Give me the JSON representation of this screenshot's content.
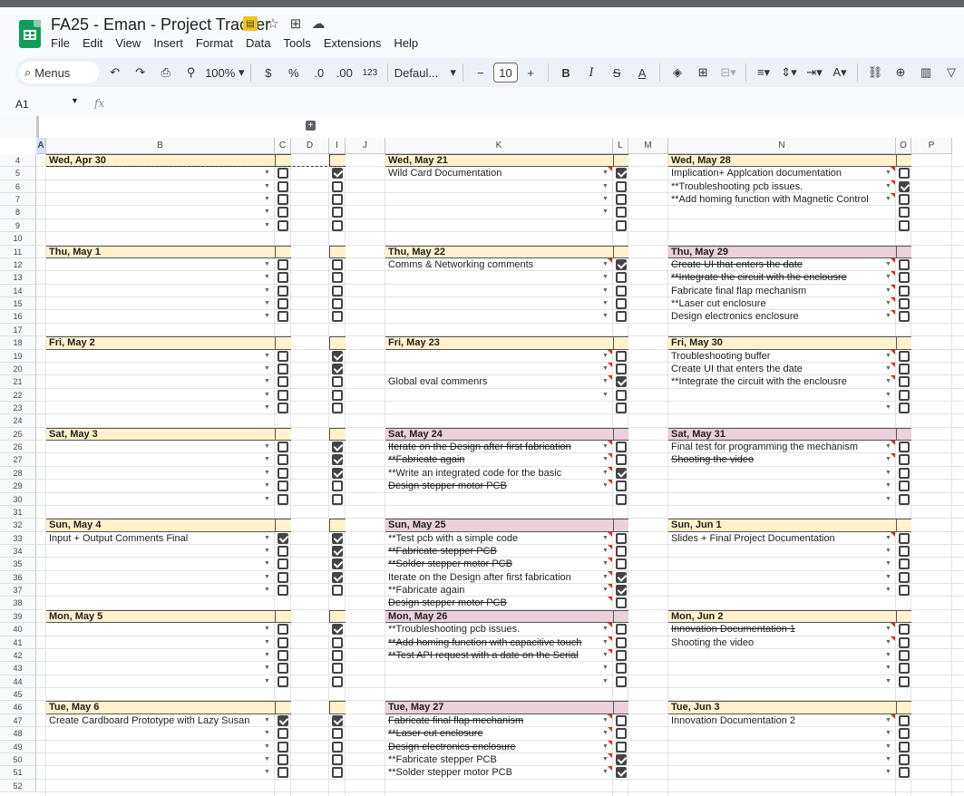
{
  "app": {
    "doc_title": "FA25 - Eman - Project Tracker",
    "menus": [
      "File",
      "Edit",
      "View",
      "Insert",
      "Format",
      "Data",
      "Tools",
      "Extensions",
      "Help"
    ]
  },
  "toolbar": {
    "search_label": "Menus",
    "zoom": "100%",
    "currency": "$",
    "percent": "%",
    "dec_decrease": ".0",
    "dec_increase": ".00",
    "number_format": "123",
    "font": "Defaul...",
    "font_size": "10",
    "bold": "B",
    "italic": "I",
    "strike": "S",
    "textcolor": "A"
  },
  "formula": {
    "cell": "A1",
    "fx": "fx"
  },
  "columns": [
    {
      "id": "A"
    },
    {
      "id": "B"
    },
    {
      "id": "C"
    },
    {
      "id": "D"
    },
    {
      "id": "I"
    },
    {
      "id": "J"
    },
    {
      "id": "K"
    },
    {
      "id": "L"
    },
    {
      "id": "M"
    },
    {
      "id": "N"
    },
    {
      "id": "O"
    },
    {
      "id": "P"
    }
  ],
  "rows": [
    "4",
    "5",
    "6",
    "7",
    "8",
    "9",
    "10",
    "11",
    "12",
    "13",
    "14",
    "15",
    "16",
    "17",
    "18",
    "19",
    "20",
    "21",
    "22",
    "23",
    "24",
    "25",
    "26",
    "27",
    "28",
    "29",
    "30",
    "31",
    "32",
    "33",
    "34",
    "35",
    "36",
    "37",
    "38",
    "39",
    "40",
    "41",
    "42",
    "43",
    "44",
    "45",
    "46",
    "47",
    "48",
    "49",
    "50",
    "51",
    "52"
  ],
  "blocks": [
    {
      "col": "B",
      "row": 0,
      "title": "Wed, Apr 30",
      "color": "y",
      "tasks": [],
      "checks": [
        0,
        0,
        0,
        0,
        0
      ],
      "dropdowns": 5,
      "icol": [
        1,
        0,
        0,
        0,
        0
      ]
    },
    {
      "col": "B",
      "row": 7,
      "title": "Thu, May 1",
      "color": "y",
      "tasks": [],
      "checks": [
        0,
        0,
        0,
        0,
        0
      ],
      "dropdowns": 5,
      "icol": [
        0,
        0,
        0,
        0,
        0
      ]
    },
    {
      "col": "B",
      "row": 14,
      "title": "Fri, May 2",
      "color": "y",
      "tasks": [],
      "checks": [
        0,
        0,
        0,
        0,
        0
      ],
      "dropdowns": 5,
      "icol": [
        1,
        1,
        0,
        0,
        0
      ]
    },
    {
      "col": "B",
      "row": 21,
      "title": "Sat, May 3",
      "color": "y",
      "tasks": [],
      "checks": [
        0,
        0,
        0,
        0,
        0
      ],
      "dropdowns": 5,
      "icol": [
        1,
        1,
        1,
        0,
        0
      ]
    },
    {
      "col": "B",
      "row": 28,
      "title": "Sun, May 4",
      "color": "y",
      "tasks": [
        {
          "t": "Input + Output Comments Final",
          "d": false
        }
      ],
      "checks": [
        1,
        0,
        0,
        0,
        0
      ],
      "dropdowns": 5,
      "icol": [
        1,
        1,
        1,
        1,
        0
      ]
    },
    {
      "col": "B",
      "row": 35,
      "title": "Mon, May 5",
      "color": "y",
      "tasks": [],
      "checks": [
        0,
        0,
        0,
        0,
        0
      ],
      "dropdowns": 5,
      "icol": [
        1,
        0,
        0,
        0,
        0
      ]
    },
    {
      "col": "B",
      "row": 42,
      "title": "Tue, May 6",
      "color": "y",
      "tasks": [
        {
          "t": "Create Cardboard Prototype with Lazy Susan",
          "d": false
        }
      ],
      "checks": [
        1,
        0,
        0,
        0,
        0
      ],
      "dropdowns": 5,
      "icol": [
        1,
        0,
        0,
        0,
        0
      ]
    },
    {
      "col": "K",
      "row": 0,
      "title": "Wed, May 21",
      "color": "y",
      "tasks": [
        {
          "t": "Wild Card Documentation",
          "d": false
        }
      ],
      "checks": [
        1,
        0,
        0,
        0,
        0
      ],
      "dropdowns": 4
    },
    {
      "col": "K",
      "row": 7,
      "title": "Thu, May 22",
      "color": "y",
      "tasks": [
        {
          "t": "Comms & Networking comments",
          "d": false
        }
      ],
      "checks": [
        1,
        0,
        0,
        0,
        0
      ],
      "dropdowns": 5
    },
    {
      "col": "K",
      "row": 14,
      "title": "Fri, May 23",
      "color": "y",
      "tasks": [
        {
          "t": "",
          "d": false
        },
        {
          "t": "",
          "d": false
        },
        {
          "t": "Global eval commenrs",
          "d": false
        }
      ],
      "checks": [
        0,
        0,
        1,
        0,
        0
      ],
      "dropdowns": 4
    },
    {
      "col": "K",
      "row": 21,
      "title": "Sat, May 24",
      "color": "p",
      "tasks": [
        {
          "t": "Iterate on the Design after first fabrication",
          "d": true
        },
        {
          "t": "**Fabricate again",
          "d": true
        },
        {
          "t": "**Write an integrated code for the basic",
          "d": false
        },
        {
          "t": "Design stepper motor PCB",
          "d": true
        }
      ],
      "checks": [
        0,
        0,
        1,
        0,
        0
      ],
      "dropdowns": 4
    },
    {
      "col": "K",
      "row": 28,
      "title": "Sun, May 25",
      "color": "p",
      "tasks": [
        {
          "t": "**Test pcb with a simple code",
          "d": false
        },
        {
          "t": "**Fabricate stepper PCB",
          "d": true
        },
        {
          "t": "**Solder stepper motor PCB",
          "d": true
        },
        {
          "t": "Iterate on the Design after first fabrication",
          "d": false
        },
        {
          "t": "**Fabricate again",
          "d": false
        },
        {
          "t": "Design stepper motor PCB",
          "d": true
        }
      ],
      "checks": [
        0,
        0,
        0,
        1,
        1,
        0
      ],
      "dropdowns": 5
    },
    {
      "col": "K",
      "row": 35,
      "title": "Mon, May 26",
      "color": "p",
      "tasks": [
        {
          "t": "**Troubleshooting pcb issues.",
          "d": false
        },
        {
          "t": "**Add homing function with capacitive touch",
          "d": true
        },
        {
          "t": "**Test API request with a date on the Serial",
          "d": true
        }
      ],
      "checks": [
        0,
        0,
        0,
        0,
        0
      ],
      "dropdowns": 5
    },
    {
      "col": "K",
      "row": 42,
      "title": "Tue, May 27",
      "color": "p",
      "tasks": [
        {
          "t": "Fabricate final flap mechanism",
          "d": true
        },
        {
          "t": "**Laser cut enclosure",
          "d": true
        },
        {
          "t": "Design electronics enclosure",
          "d": true
        },
        {
          "t": "**Fabricate stepper PCB",
          "d": false
        },
        {
          "t": "**Solder stepper motor PCB",
          "d": false
        }
      ],
      "checks": [
        0,
        0,
        0,
        1,
        1
      ],
      "dropdowns": 5
    },
    {
      "col": "N",
      "row": 0,
      "title": "Wed, May 28",
      "color": "y",
      "tasks": [
        {
          "t": "Implication+ Applcation documentation",
          "d": false
        },
        {
          "t": "**Troubleshooting pcb issues.",
          "d": false
        },
        {
          "t": "**Add homing function with Magnetic Control",
          "d": false
        }
      ],
      "checks": [
        0,
        1,
        0,
        0,
        0
      ],
      "dropdowns": 3
    },
    {
      "col": "N",
      "row": 7,
      "title": "Thu, May 29",
      "color": "p",
      "tasks": [
        {
          "t": "Create UI that enters the date",
          "d": true
        },
        {
          "t": "**Integrate the circuit with the enclousre",
          "d": true
        },
        {
          "t": "Fabricate final flap mechanism",
          "d": false
        },
        {
          "t": "**Laser cut enclosure",
          "d": false
        },
        {
          "t": "Design electronics enclosure",
          "d": false
        }
      ],
      "checks": [
        0,
        0,
        0,
        0,
        0
      ],
      "dropdowns": 5
    },
    {
      "col": "N",
      "row": 14,
      "title": "Fri, May 30",
      "color": "y",
      "tasks": [
        {
          "t": "Troubleshooting buffer",
          "d": false
        },
        {
          "t": "Create UI that enters the date",
          "d": false
        },
        {
          "t": "**Integrate the circuit with the enclousre",
          "d": false
        }
      ],
      "checks": [
        0,
        0,
        0,
        0,
        0
      ],
      "dropdowns": 5
    },
    {
      "col": "N",
      "row": 21,
      "title": "Sat, May 31",
      "color": "p",
      "tasks": [
        {
          "t": "Final test for programming the  mechanism",
          "d": false
        },
        {
          "t": "Shooting the video",
          "d": true
        }
      ],
      "checks": [
        0,
        0,
        0,
        0,
        0
      ],
      "dropdowns": 5
    },
    {
      "col": "N",
      "row": 28,
      "title": "Sun, Jun 1",
      "color": "y",
      "tasks": [
        {
          "t": "Slides + Final Project Documentation",
          "d": false
        }
      ],
      "checks": [
        0,
        0,
        0,
        0,
        0
      ],
      "dropdowns": 5
    },
    {
      "col": "N",
      "row": 35,
      "title": "Mon, Jun 2",
      "color": "y",
      "tasks": [
        {
          "t": "Innovation Documentation 1",
          "d": true
        },
        {
          "t": "Shooting the video",
          "d": false
        }
      ],
      "checks": [
        0,
        0,
        0,
        0,
        0
      ],
      "dropdowns": 5
    },
    {
      "col": "N",
      "row": 42,
      "title": "Tue, Jun 3",
      "color": "y",
      "tasks": [
        {
          "t": "Innovation Documentation 2",
          "d": false
        }
      ],
      "checks": [
        0,
        0,
        0,
        0,
        0
      ],
      "dropdowns": 5
    }
  ],
  "colors": {
    "header_yellow": "#fff2cc",
    "header_pink": "#ead1dc",
    "accent": "#0f9d58"
  }
}
